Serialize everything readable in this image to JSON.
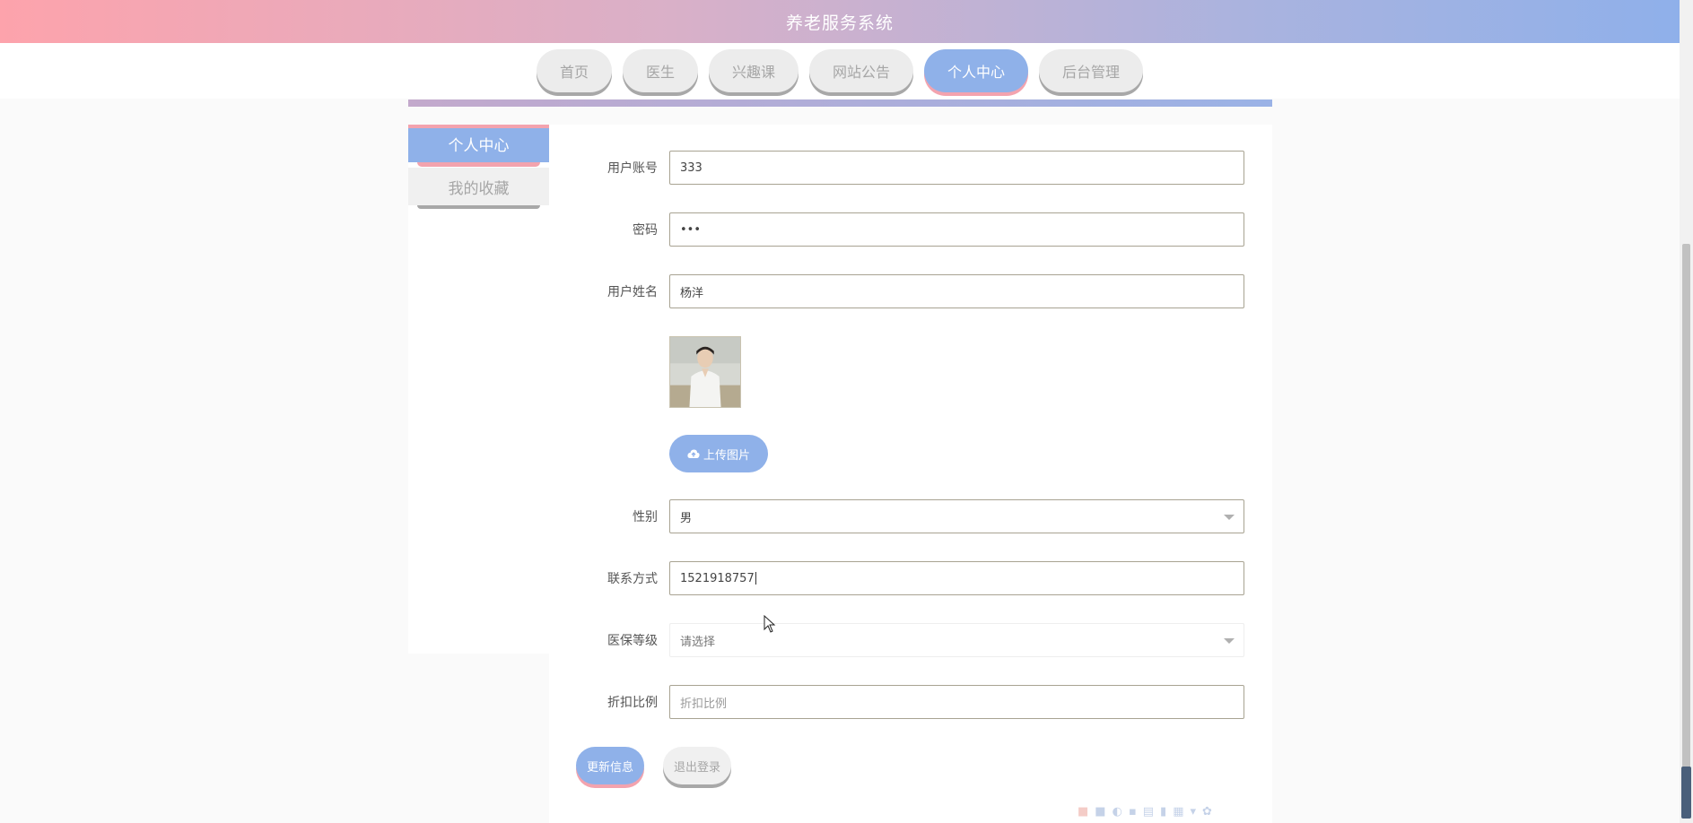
{
  "header": {
    "title": "养老服务系统"
  },
  "nav": {
    "tabs": [
      {
        "label": "首页",
        "active": false
      },
      {
        "label": "医生",
        "active": false
      },
      {
        "label": "兴趣课",
        "active": false
      },
      {
        "label": "网站公告",
        "active": false
      },
      {
        "label": "个人中心",
        "active": true
      },
      {
        "label": "后台管理",
        "active": false
      }
    ]
  },
  "sidebar": {
    "items": [
      {
        "label": "个人中心",
        "active": true
      },
      {
        "label": "我的收藏",
        "active": false
      }
    ]
  },
  "form": {
    "account": {
      "label": "用户账号",
      "value": "333"
    },
    "password": {
      "label": "密码",
      "value": "•••"
    },
    "name": {
      "label": "用户姓名",
      "value": "杨洋"
    },
    "upload": {
      "label": "上传图片",
      "icon": "cloud-upload-icon"
    },
    "gender": {
      "label": "性别",
      "value": "男"
    },
    "phone": {
      "label": "联系方式",
      "value": "1521918757"
    },
    "insurance": {
      "label": "医保等级",
      "placeholder": "请选择"
    },
    "discount": {
      "label": "折扣比例",
      "placeholder": "折扣比例"
    }
  },
  "actions": {
    "update": "更新信息",
    "logout": "退出登录"
  },
  "colors": {
    "accent": "#8fb1e9",
    "accent_shadow": "#f3a3ae",
    "header_gradient_start": "#fda3ac",
    "header_gradient_end": "#8fb0ea"
  }
}
